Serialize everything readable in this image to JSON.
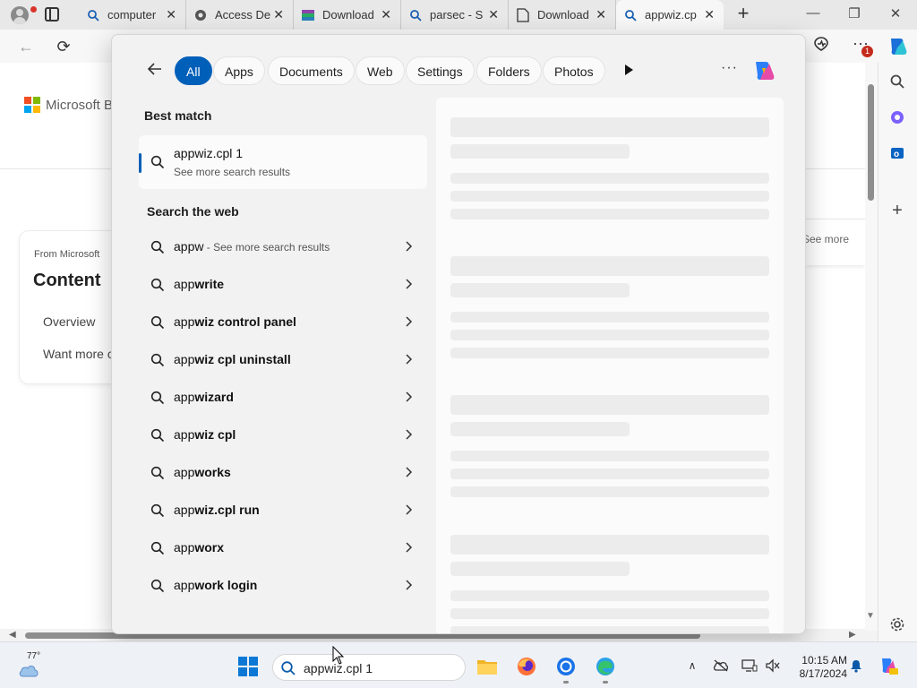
{
  "browser": {
    "tabs": [
      {
        "label": "computer",
        "icon": "search-icon"
      },
      {
        "label": "Access De",
        "icon": "settings-icon"
      },
      {
        "label": "Download",
        "icon": "winrar-icon"
      },
      {
        "label": "parsec - S",
        "icon": "search-icon"
      },
      {
        "label": "Download",
        "icon": "document-icon"
      },
      {
        "label": "appwiz.cp",
        "icon": "search-icon"
      }
    ],
    "new_tab_label": "+",
    "notification_count": "1"
  },
  "page": {
    "logo_text": "Microsoft B",
    "card_source": "From Microsoft",
    "card_title": "Content",
    "card_links": [
      "Overview",
      "Want more c"
    ],
    "see_more": "See more"
  },
  "search_flyout": {
    "filters": [
      "All",
      "Apps",
      "Documents",
      "Web",
      "Settings",
      "Folders",
      "Photos"
    ],
    "active_filter": "All",
    "best_match_heading": "Best match",
    "best_match": {
      "title": "appwiz.cpl 1",
      "subtitle": "See more search results"
    },
    "web_heading": "Search the web",
    "web_results": [
      {
        "bold": "appw",
        "rest": "",
        "sub": " - See more search results"
      },
      {
        "bold": "app",
        "rest": "write",
        "sub": ""
      },
      {
        "bold": "app",
        "rest": "wiz control panel",
        "sub": ""
      },
      {
        "bold": "app",
        "rest": "wiz cpl uninstall",
        "sub": ""
      },
      {
        "bold": "app",
        "rest": "wizard",
        "sub": ""
      },
      {
        "bold": "app",
        "rest": "wiz cpl",
        "sub": ""
      },
      {
        "bold": "app",
        "rest": "works",
        "sub": ""
      },
      {
        "bold": "app",
        "rest": "wiz.cpl run",
        "sub": ""
      },
      {
        "bold": "app",
        "rest": "worx",
        "sub": ""
      },
      {
        "bold": "app",
        "rest": "work login",
        "sub": ""
      }
    ],
    "preview_state": "loading"
  },
  "taskbar": {
    "weather_temp": "77°",
    "search_value": "appwiz.cpl 1",
    "time": "10:15 AM",
    "date": "8/17/2024",
    "apps": [
      "start-icon",
      "file-explorer-icon",
      "firefox-icon",
      "chrome-icon",
      "edge-icon"
    ]
  },
  "colors": {
    "accent": "#005fb8",
    "ms_red": "#f25022",
    "ms_green": "#7fba00",
    "ms_blue": "#00a4ef",
    "ms_yellow": "#ffb900"
  }
}
